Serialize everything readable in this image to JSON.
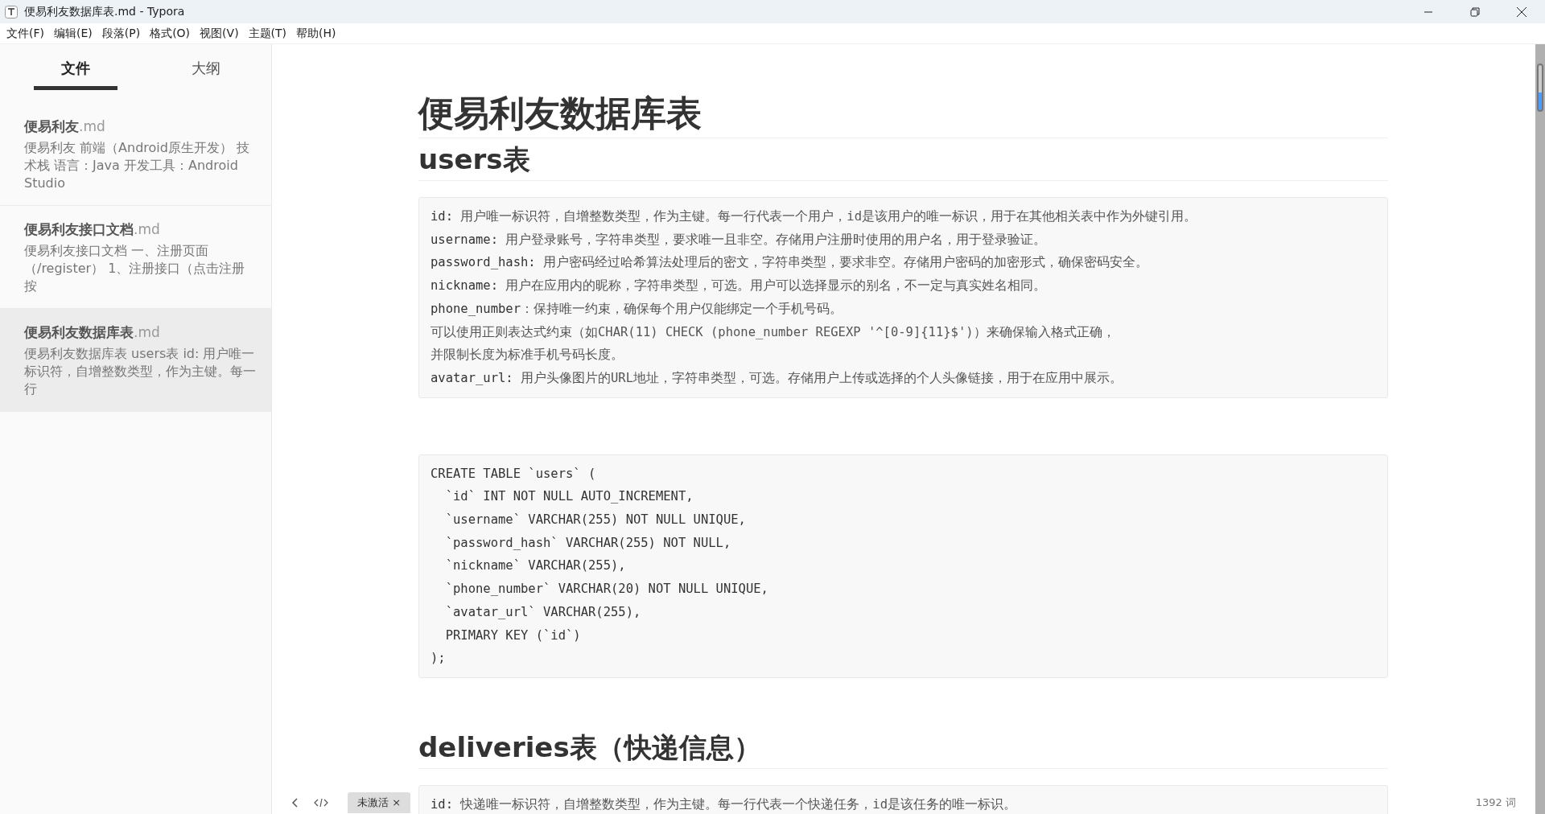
{
  "window": {
    "title": "便易利友数据库表.md - Typora"
  },
  "menu": [
    "文件(F)",
    "编辑(E)",
    "段落(P)",
    "格式(O)",
    "视图(V)",
    "主题(T)",
    "帮助(H)"
  ],
  "sidebar": {
    "tabs": [
      {
        "label": "文件",
        "selected": true
      },
      {
        "label": "大纲",
        "selected": false
      }
    ],
    "files": [
      {
        "name": "便易利友",
        "ext": ".md",
        "snippet": "便易利友 前端（Android原生开发） 技术栈 语言：Java 开发工具：Android Studio",
        "selected": false
      },
      {
        "name": "便易利友接口文档",
        "ext": ".md",
        "snippet": "便易利友接口文档 一、注册页面（/register） 1、注册接口（点击注册按",
        "selected": false
      },
      {
        "name": "便易利友数据库表",
        "ext": ".md",
        "snippet": "便易利友数据库表 users表 id: 用户唯一标识符，自增整数类型，作为主键。每一行",
        "selected": true
      }
    ]
  },
  "document": [
    {
      "kind": "h1",
      "text": "便易利友数据库表"
    },
    {
      "kind": "h2",
      "text": "users表"
    },
    {
      "kind": "fields",
      "lines": [
        {
          "key": "id:",
          "text": " 用户唯一标识符，自增整数类型，作为主键。每一行代表一个用户，id是该用户的唯一标识，用于在其他相关表中作为外键引用。"
        },
        {
          "key": "username:",
          "text": " 用户登录账号，字符串类型，要求唯一且非空。存储用户注册时使用的用户名，用于登录验证。"
        },
        {
          "key": "password_hash:",
          "text": " 用户密码经过哈希算法处理后的密文，字符串类型，要求非空。存储用户密码的加密形式，确保密码安全。"
        },
        {
          "key": "nickname:",
          "text": " 用户在应用内的昵称，字符串类型，可选。用户可以选择显示的别名，不一定与真实姓名相同。"
        },
        {
          "key": "phone_number",
          "text": "：保持唯一约束，确保每个用户仅能绑定一个手机号码。"
        },
        {
          "text": "可以使用正则表达式约束（如CHAR(11) CHECK (phone_number REGEXP '^[0-9]{11}$')）来确保输入格式正确，"
        },
        {
          "text": "并限制长度为标准手机号码长度。"
        },
        {
          "key": "avatar_url:",
          "text": " 用户头像图片的URL地址，字符串类型，可选。存储用户上传或选择的个人头像链接，用于在应用中展示。"
        }
      ]
    },
    {
      "kind": "code",
      "lines": [
        "CREATE TABLE `users` (",
        "  `id` INT NOT NULL AUTO_INCREMENT,",
        "  `username` VARCHAR(255) NOT NULL UNIQUE,",
        "  `password_hash` VARCHAR(255) NOT NULL,",
        "  `nickname` VARCHAR(255),",
        "  `phone_number` VARCHAR(20) NOT NULL UNIQUE,",
        "  `avatar_url` VARCHAR(255),",
        "  PRIMARY KEY (`id`)",
        ");"
      ]
    },
    {
      "kind": "h2",
      "text": "deliveries表（快递信息）"
    },
    {
      "kind": "fields",
      "lines": [
        {
          "key": "id:",
          "text": " 快递唯一标识符，自增整数类型，作为主键。每一行代表一个快递任务，id是该任务的唯一标识。"
        }
      ]
    }
  ],
  "footer": {
    "badge": "未激活 ×",
    "word_count": "1392 词"
  }
}
